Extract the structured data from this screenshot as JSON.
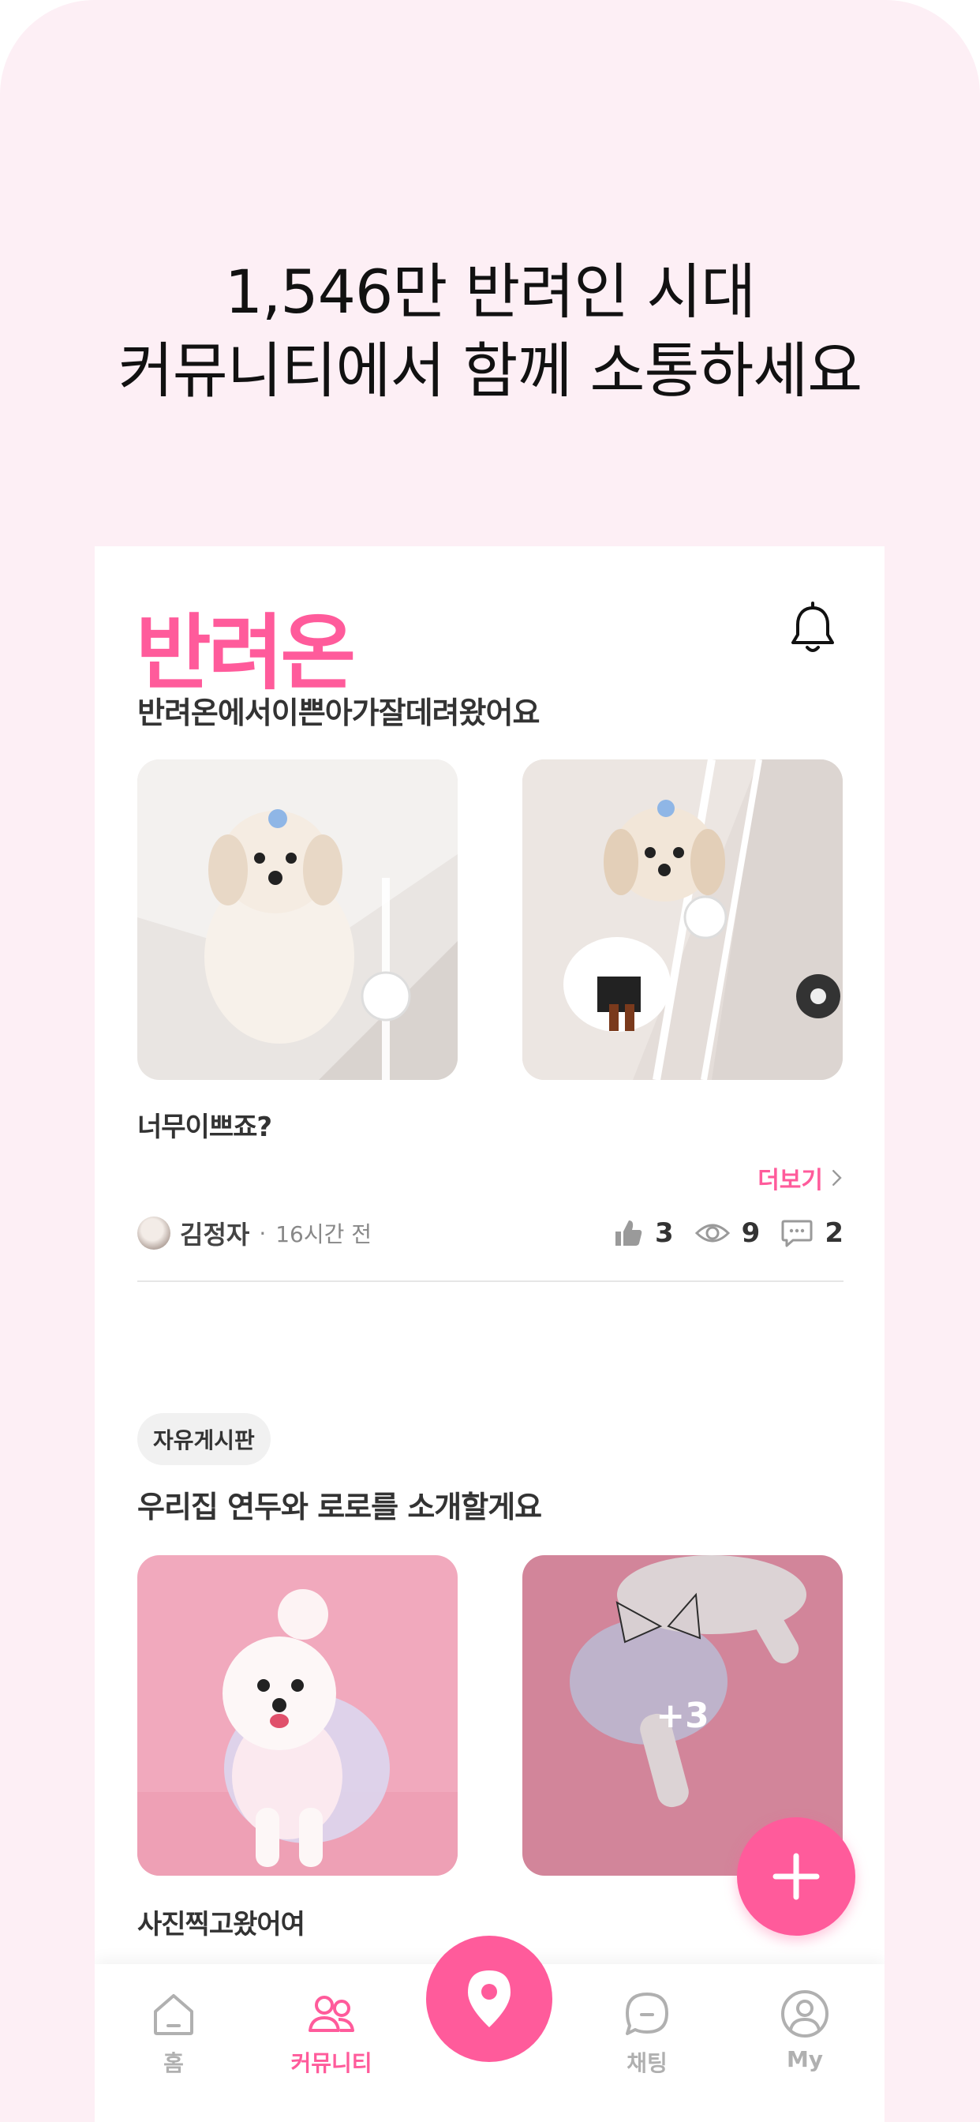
{
  "headline": {
    "line1": "1,546만 반려인 시대",
    "line2": "커뮤니티에서 함께 소통하세요"
  },
  "app": {
    "logo": "반려온",
    "accent_color": "#ff5b9b",
    "notification_icon": "bell-icon"
  },
  "post1": {
    "title": "반려온에서이쁜아가잘데려왔어요",
    "caption": "너무이쁘죠?",
    "more_label": "더보기",
    "author": "김정자",
    "separator": "·",
    "time": "16시간 전",
    "likes": "3",
    "views": "9",
    "comments": "2"
  },
  "post2": {
    "tag": "자유게시판",
    "title": "우리집 연두와 로로를 소개할게요",
    "extra_photos": "+3",
    "caption": "사진찍고왔어여"
  },
  "tabbar": {
    "items": [
      {
        "label": "홈",
        "icon": "home-icon"
      },
      {
        "label": "커뮤니티",
        "icon": "community-icon"
      },
      {
        "label": "",
        "icon": "map-pin-icon"
      },
      {
        "label": "채팅",
        "icon": "chat-icon"
      },
      {
        "label": "My",
        "icon": "profile-icon"
      }
    ]
  }
}
